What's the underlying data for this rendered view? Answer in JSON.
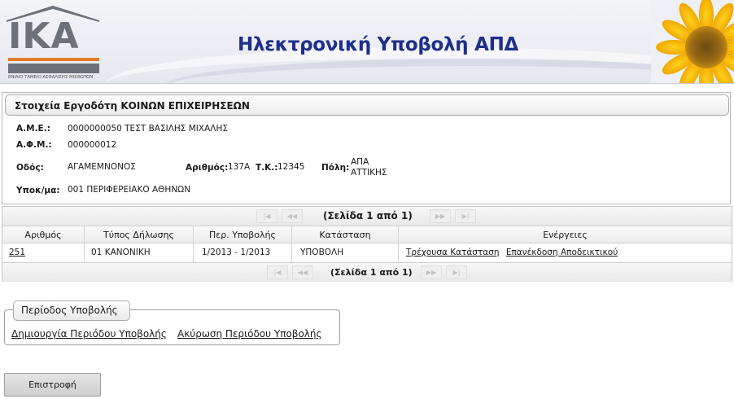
{
  "header": {
    "logo_text": "IKA",
    "logo_tagline": "ΕΝΙΑΙΟ ΤΑΜΕΙΟ ΑΣΦΑΛΙΣΗΣ ΜΙΣΘΩΤΩΝ",
    "title": "Ηλεκτρονική Υποβολή ΑΠΔ"
  },
  "employer": {
    "title": "Στοιχεία Εργοδότη ΚΟΙΝΩΝ ΕΠΙΧΕΙΡΗΣΕΩΝ",
    "ame_label": "Α.Μ.Ε.:",
    "ame_value": "0000000050 ΤΕΣΤ ΒΑΣΙΛΗΣ ΜΙΧΑΛΗΣ",
    "afm_label": "Α.Φ.Μ.:",
    "afm_value": "000000012",
    "street_label": "Οδός:",
    "street_value": "ΑΓΑΜΕΜΝΟΝΟΣ",
    "number_label": "Αριθμός:",
    "number_value": "137Α",
    "tk_label": "Τ.Κ.:",
    "tk_value": "12345",
    "city_label": "Πόλη:",
    "city_value_line1": "ΑΠΑ",
    "city_value_line2": "ΑΤΤΙΚΗΣ",
    "branch_label": "Υποκ/μα:",
    "branch_value": "001 ΠΕΡΙΦΕΡΕΙΑΚΟ ΑΘΗΝΩΝ"
  },
  "pager": {
    "top_text": "(Σελίδα 1 από 1)",
    "bottom_text": "(Σελίδα 1 από 1)",
    "first_glyph": "|◀",
    "prev_glyph": "◀◀",
    "next_glyph": "▶▶",
    "last_glyph": "▶|"
  },
  "table": {
    "columns": [
      "Αριθμός",
      "Τύπος Δήλωσης",
      "Περ. Υποβολής",
      "Κατάσταση",
      "Ενέργειες"
    ],
    "rows": [
      {
        "number": "251",
        "type": "01 ΚΑΝΟΝΙΚΗ",
        "period": "1/2013 - 1/2013",
        "status": "ΥΠΟΒΟΛΗ",
        "action_status": "Τρέχουσα Κατάσταση",
        "action_reissue": "Επανέκδοση Αποδεικτικού"
      }
    ]
  },
  "period_section": {
    "legend": "Περίοδος Υποβολής",
    "create_link": "Δημιουργία Περιόδου Υποβολής",
    "cancel_link": "Ακύρωση Περιόδου Υποβολής"
  },
  "return_button": "Επιστροφή",
  "colors": {
    "title_blue": "#1e2f8a",
    "logo_gray": "#6d7179",
    "logo_orange": "#e27d2b"
  }
}
